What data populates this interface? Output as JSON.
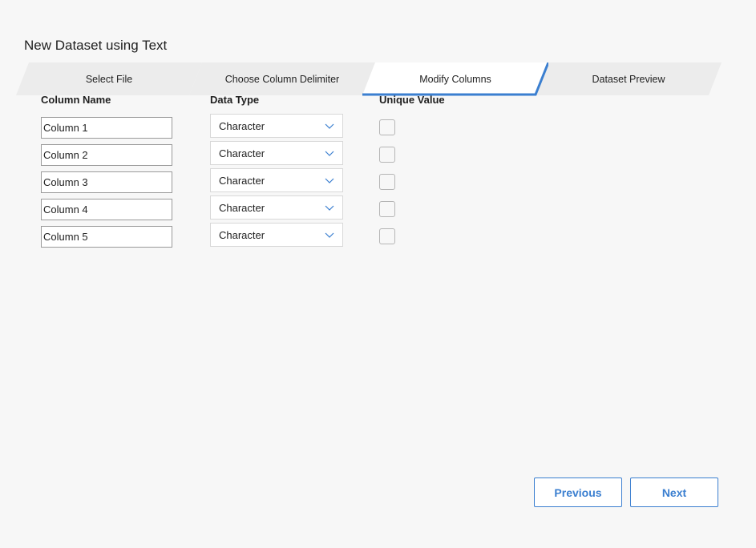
{
  "title": "New Dataset using Text",
  "steps": [
    {
      "label": "Select File",
      "active": false
    },
    {
      "label": "Choose Column Delimiter",
      "active": false
    },
    {
      "label": "Modify Columns",
      "active": true
    },
    {
      "label": "Dataset Preview",
      "active": false
    }
  ],
  "headers": {
    "name": "Column Name",
    "type": "Data Type",
    "unique": "Unique Value"
  },
  "rows": [
    {
      "name": "Column 1",
      "type": "Character",
      "unique": false
    },
    {
      "name": "Column 2",
      "type": "Character",
      "unique": false
    },
    {
      "name": "Column 3",
      "type": "Character",
      "unique": false
    },
    {
      "name": "Column 4",
      "type": "Character",
      "unique": false
    },
    {
      "name": "Column 5",
      "type": "Character",
      "unique": false
    }
  ],
  "buttons": {
    "previous": "Previous",
    "next": "Next"
  },
  "colors": {
    "accent": "#3b7fd0",
    "background": "#f7f7f7",
    "step_inactive": "#ececec"
  },
  "icons": {
    "dropdown": "chevron-down-icon"
  }
}
